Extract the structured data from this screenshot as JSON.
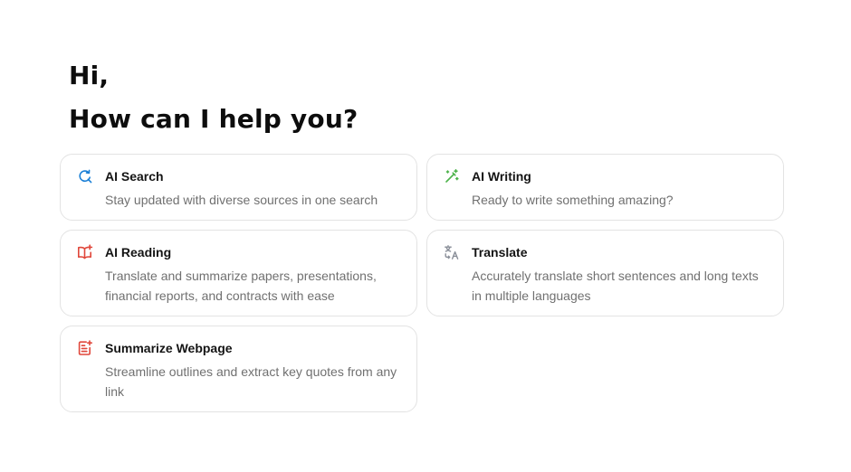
{
  "greeting": "Hi,",
  "headline": "How can I help you?",
  "colors": {
    "search_icon": "#1a7fd6",
    "writing_icon": "#4cb24a",
    "reading_icon": "#e0463a",
    "translate_icon": "#8a8f99",
    "summarize_icon": "#e0463a",
    "card_border": "#e3e3e3",
    "description_text": "#707070"
  },
  "cards": [
    {
      "icon": "search-refresh-icon",
      "title": "AI Search",
      "description": "Stay updated with diverse sources in one search"
    },
    {
      "icon": "magic-pen-icon",
      "title": "AI Writing",
      "description": "Ready to write something amazing?"
    },
    {
      "icon": "book-sparkle-icon",
      "title": "AI Reading",
      "description": "Translate and summarize papers, presentations, financial reports, and contracts with ease"
    },
    {
      "icon": "translate-icon",
      "title": "Translate",
      "description": "Accurately translate short sentences and long texts in multiple languages"
    },
    {
      "icon": "document-sparkle-icon",
      "title": "Summarize Webpage",
      "description": "Streamline outlines and extract key quotes from any link"
    }
  ]
}
